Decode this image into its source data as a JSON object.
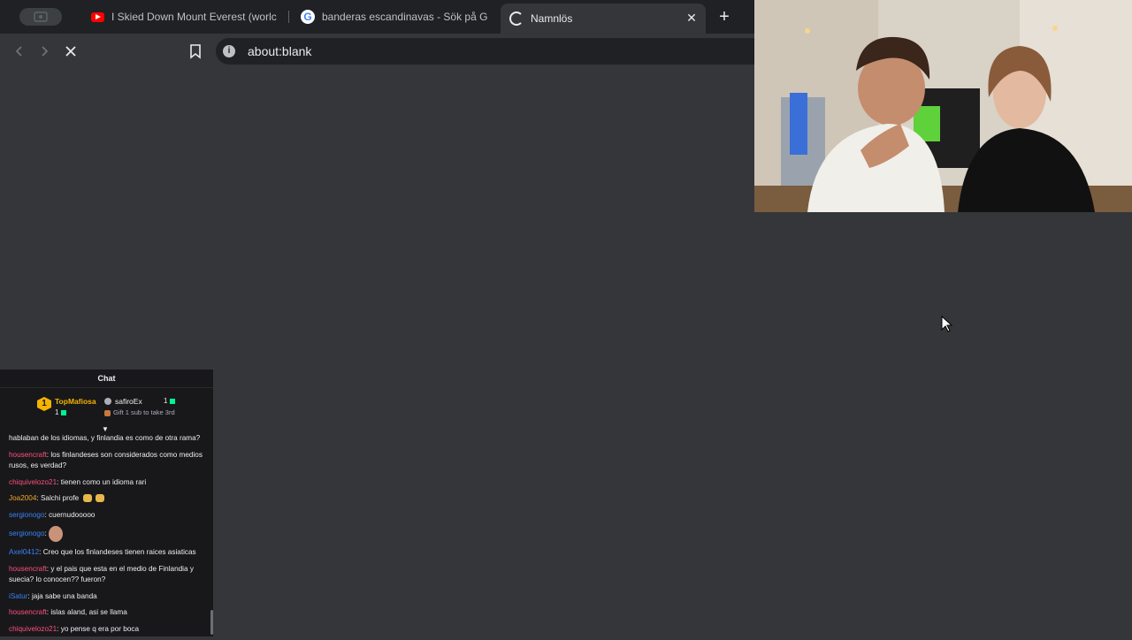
{
  "browser": {
    "tabs": [
      {
        "title": "I Skied Down Mount Everest (worlc",
        "favicon": "youtube-icon"
      },
      {
        "title": "banderas escandinavas - Sök på G",
        "favicon": "google-icon"
      },
      {
        "title": "Namnlös",
        "favicon": "loading-spinner",
        "active": true
      }
    ],
    "address": "about:blank"
  },
  "chat": {
    "header": "Chat",
    "leaderboard": {
      "first": {
        "rank": "1",
        "name": "TopMafiosa",
        "count": "1"
      },
      "second": {
        "name": "safiroEx",
        "count": "1",
        "gift_text": "Gift 1 sub to take 3rd"
      }
    },
    "messages": [
      {
        "user": "",
        "text": "hablaban de los idiomas, y finlandia es como de otra rama?",
        "color": "#efeff1"
      },
      {
        "user": "housencraft",
        "text": ": los finlandeses son considerados como medios rusos, es verdad?",
        "color": "#ff4f7b"
      },
      {
        "user": "chiquivelozo21",
        "text": ": tienen como un idioma rari",
        "color": "#ff4f7b"
      },
      {
        "user": "Joa2004",
        "text": ": Salchi profe",
        "color": "#f5a623"
      },
      {
        "user": "sergionogo",
        "text": ": cuernudooooo",
        "color": "#3a82f6"
      },
      {
        "user": "sergionogo",
        "text": ":",
        "color": "#3a82f6"
      },
      {
        "user": "Axel0412",
        "text": ": Creo que los finlandeses tienen raices asiaticas",
        "color": "#3a82f6"
      },
      {
        "user": "housencraft",
        "text": ": y el pais que esta en el medio de Finlandia y suecia? lo conocen?? fueron?",
        "color": "#ff4f7b"
      },
      {
        "user": "iSatur",
        "text": ": jaja sabe una banda",
        "color": "#3a82f6"
      },
      {
        "user": "housencraft",
        "text": ": islas aland, asi se llama",
        "color": "#ff4f7b"
      },
      {
        "user": "chiquivelozo21",
        "text": ": yo pense q era por boca",
        "color": "#ff4f7b"
      }
    ]
  },
  "colors": {
    "page_bg": "#35363a",
    "tabstrip_bg": "#202124",
    "chat_bg": "#18181b"
  }
}
